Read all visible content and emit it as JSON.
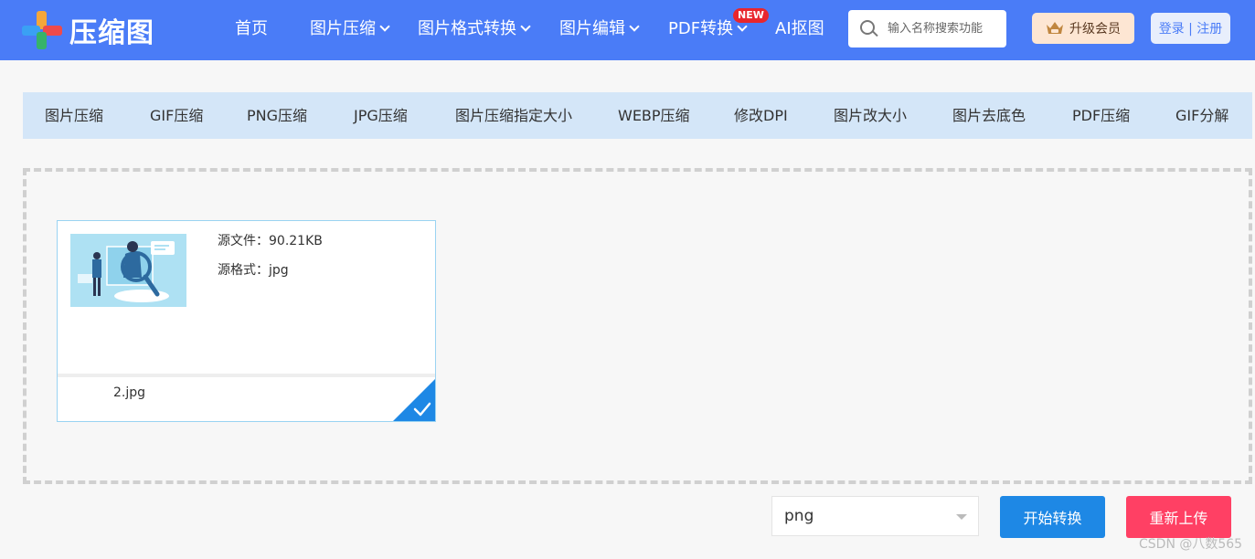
{
  "header": {
    "logo_text": "压缩图",
    "nav": [
      {
        "label": "首页",
        "has_dropdown": false
      },
      {
        "label": "图片压缩",
        "has_dropdown": true
      },
      {
        "label": "图片格式转换",
        "has_dropdown": true
      },
      {
        "label": "图片编辑",
        "has_dropdown": true
      },
      {
        "label": "PDF转换",
        "has_dropdown": true,
        "badge": "NEW"
      },
      {
        "label": "AI抠图",
        "has_dropdown": false
      }
    ],
    "search_placeholder": "输入名称搜索功能",
    "vip_label": "升级会员",
    "login_label": "登录 | 注册"
  },
  "tabs": [
    "图片压缩",
    "GIF压缩",
    "PNG压缩",
    "JPG压缩",
    "图片压缩指定大小",
    "WEBP压缩",
    "修改DPI",
    "图片改大小",
    "图片去底色",
    "PDF压缩",
    "GIF分解"
  ],
  "file": {
    "source_size_label": "源文件：90.21KB",
    "source_format_label": "源格式：jpg",
    "name": "2.jpg",
    "selected": true
  },
  "controls": {
    "format_value": "png",
    "start_label": "开始转换",
    "reupload_label": "重新上传"
  },
  "watermark": "CSDN @八数565",
  "colors": {
    "header_bg": "#4a7cf7",
    "tab_bar_bg": "#d4e6f8",
    "start_button": "#1e88e5",
    "reupload_button": "#ff4064",
    "new_badge": "#e8262d"
  }
}
